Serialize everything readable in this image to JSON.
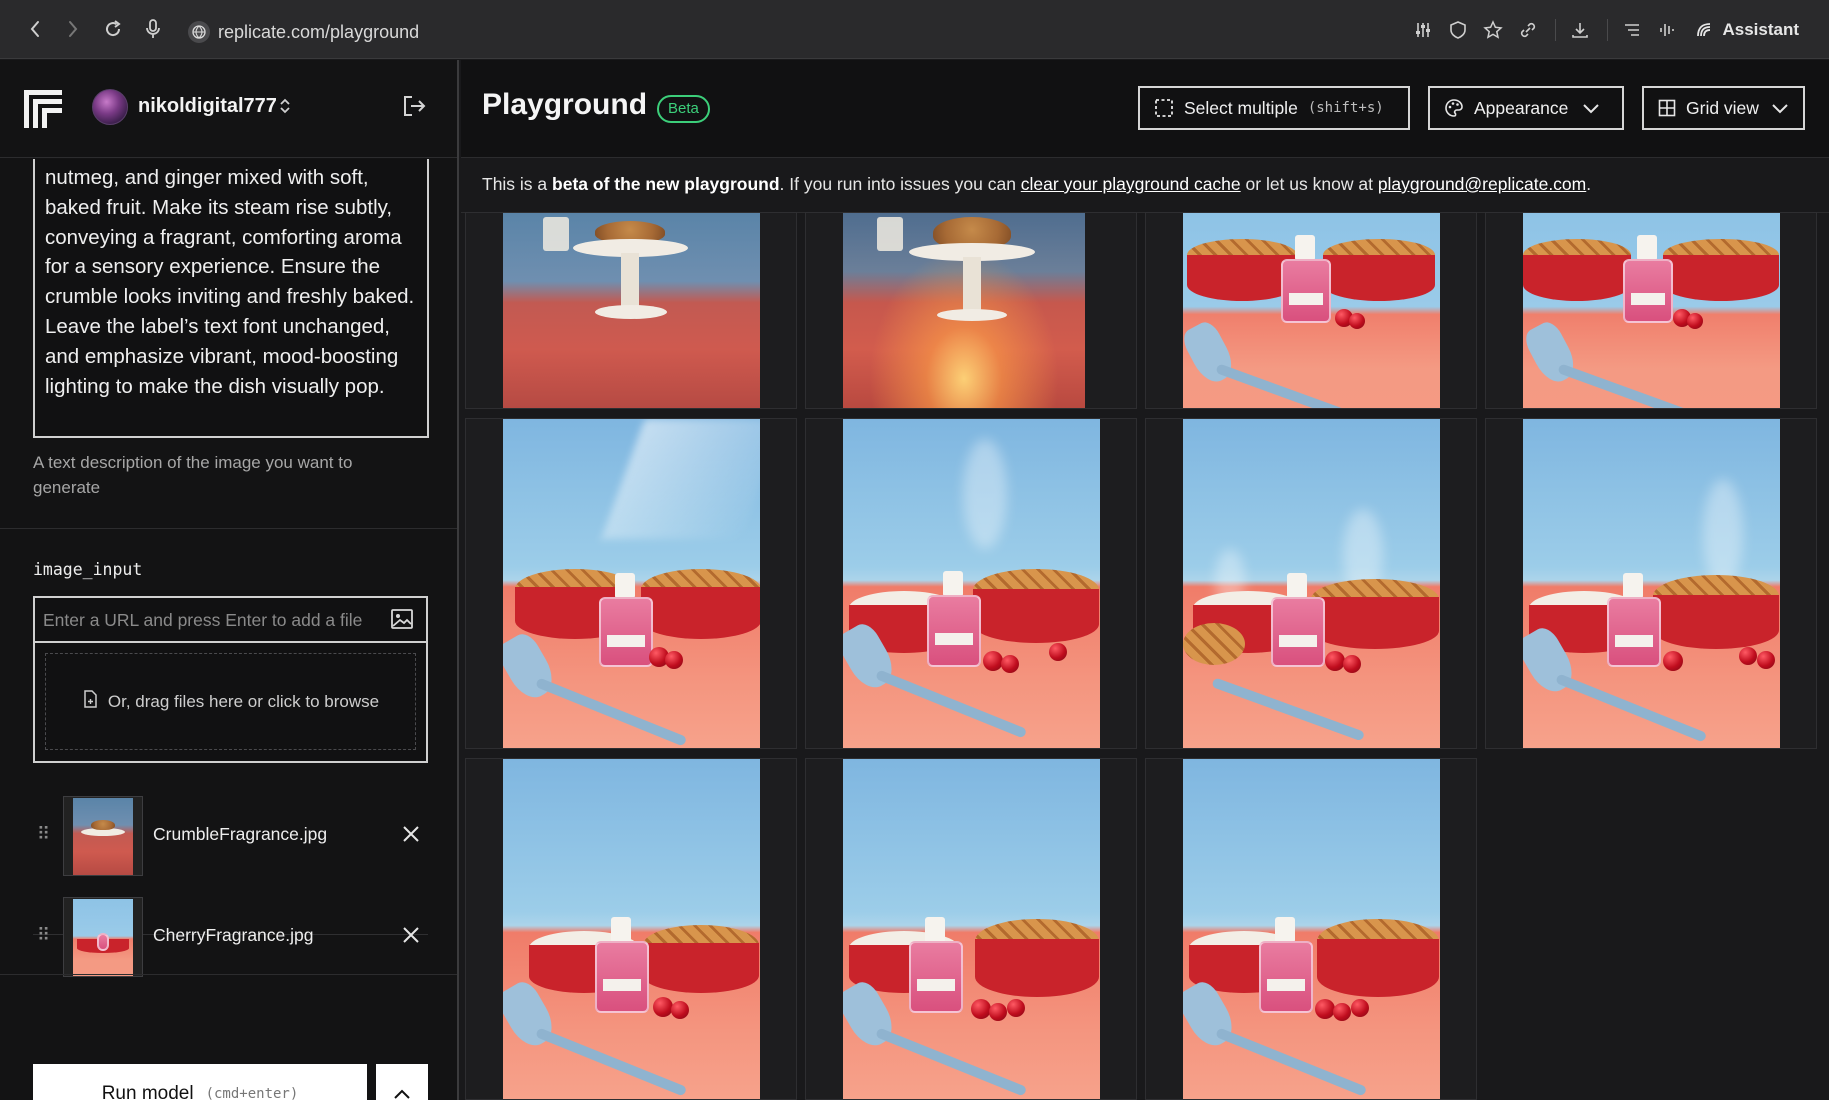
{
  "browser": {
    "url": "replicate.com/playground",
    "assistant_label": "Assistant"
  },
  "sidebar": {
    "username": "nikoldigital777",
    "prompt_text": "nutmeg, and ginger mixed with soft, baked fruit. Make its steam rise subtly, conveying a fragrant, comforting aroma for a sensory experience. Ensure the crumble looks inviting and freshly baked. Leave the label’s text font unchanged, and emphasize vibrant, mood-boosting lighting to make the dish visually pop.",
    "prompt_help": "A text description of the image you want to generate",
    "image_input_label": "image_input",
    "url_placeholder": "Enter a URL and press Enter to add a file",
    "drop_text": "Or, drag files here or click to browse",
    "files": [
      {
        "name": "CrumbleFragrance.jpg"
      },
      {
        "name": "CherryFragrance.jpg"
      }
    ],
    "run_label": "Run model",
    "run_shortcut": "(cmd+enter)"
  },
  "header": {
    "title": "Playground",
    "badge": "Beta",
    "select_multiple_label": "Select multiple",
    "select_multiple_shortcut": "(shift+s)",
    "appearance_label": "Appearance",
    "view_label": "Grid view"
  },
  "notice": {
    "prefix": "This is a ",
    "bold": "beta of the new playground",
    "middle": ". If you run into issues you can ",
    "link_cache": "clear your playground cache",
    "middle2": " or let us know at ",
    "link_email": "playground@replicate.com",
    "suffix": "."
  },
  "colors": {
    "accent_green": "#3ccf7a",
    "background": "#19191b",
    "panel": "#111112"
  }
}
